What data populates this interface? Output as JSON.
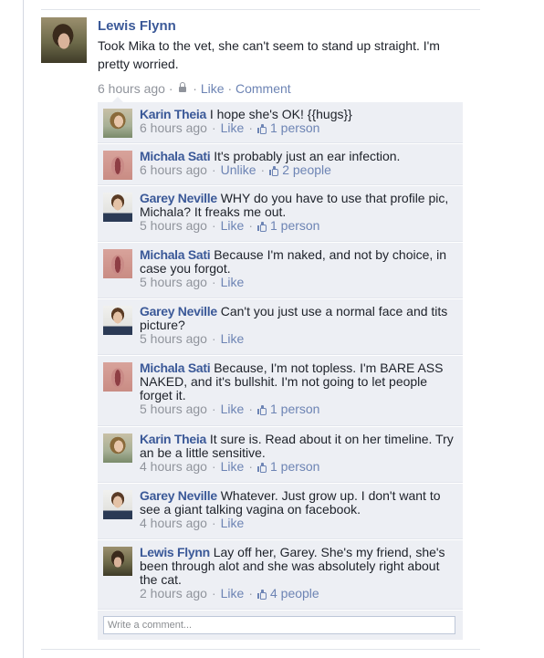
{
  "post": {
    "author": "Lewis Flynn",
    "text": "Took Mika to the vet, she can't seem to stand up straight. I'm pretty worried.",
    "time": "6 hours ago",
    "separator": "·",
    "like_label": "Like",
    "comment_label": "Comment"
  },
  "comments": [
    {
      "name": "Karin Theia",
      "text": "I hope she's OK! {{hugs}}",
      "time": "6 hours ago",
      "action": "Like",
      "likes": "1 person"
    },
    {
      "name": "Michala Sati",
      "text": "It's probably just an ear infection.",
      "time": "6 hours ago",
      "action": "Unlike",
      "likes": "2 people"
    },
    {
      "name": "Garey Neville",
      "text": "WHY do you have to use that profile pic, Michala? It freaks me out.",
      "time": "5 hours ago",
      "action": "Like",
      "likes": "1 person"
    },
    {
      "name": "Michala Sati",
      "text": "Because I'm naked, and not by choice, in case you forgot.",
      "time": "5 hours ago",
      "action": "Like",
      "likes": ""
    },
    {
      "name": "Garey Neville",
      "text": "Can't you just use a normal face and tits picture?",
      "time": "5 hours ago",
      "action": "Like",
      "likes": ""
    },
    {
      "name": "Michala Sati",
      "text": "Because, I'm not topless. I'm BARE ASS NAKED, and it's bullshit. I'm not going to let people forget it.",
      "time": "5 hours ago",
      "action": "Like",
      "likes": "1 person"
    },
    {
      "name": "Karin Theia",
      "text": "It sure is. Read about it on her timeline. Try an be a little sensitive.",
      "time": "4 hours ago",
      "action": "Like",
      "likes": "1 person"
    },
    {
      "name": "Garey Neville",
      "text": "Whatever. Just grow up. I don't want to see a giant talking vagina on facebook.",
      "time": "4 hours ago",
      "action": "Like",
      "likes": ""
    },
    {
      "name": "Lewis Flynn",
      "text": "Lay off her, Garey. She's my friend, she's been through alot and she was absolutely right about the cat.",
      "time": "2 hours ago",
      "action": "Like",
      "likes": "4 people"
    }
  ],
  "composer": {
    "placeholder": "Write a comment..."
  },
  "icons": {
    "privacy": "lock-icon",
    "like": "thumbs-up-icon"
  },
  "colors": {
    "name_link": "#3b5998",
    "meta": "#90949c",
    "comment_bg": "#edeff4"
  }
}
